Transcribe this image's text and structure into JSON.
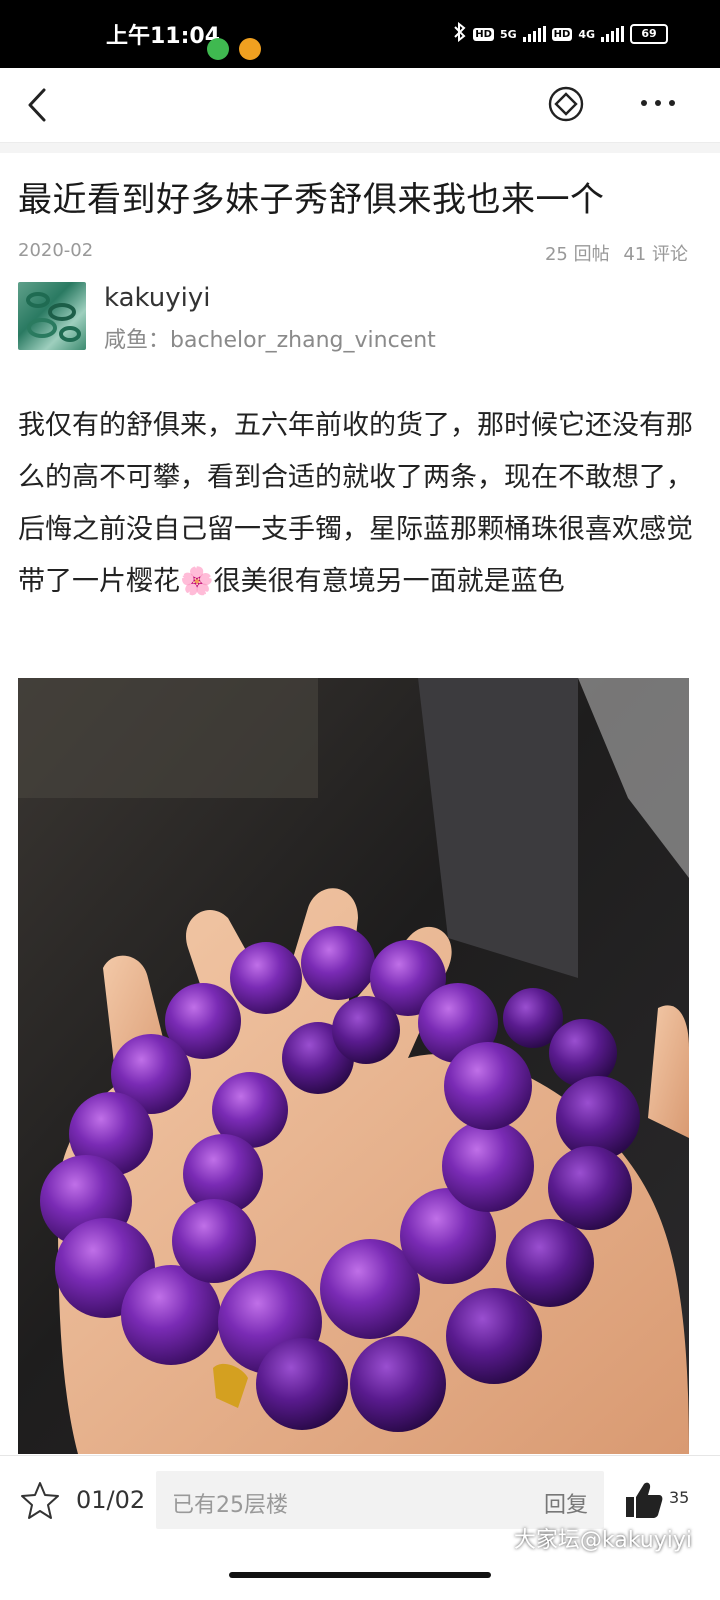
{
  "status_bar": {
    "time": "上午11:04",
    "net1": "5G",
    "net2": "4G",
    "hd": "HD",
    "battery": "69"
  },
  "post": {
    "title": "最近看到好多妹子秀舒俱来我也来一个",
    "date": "2020-02",
    "replies": "25 回帖",
    "comments": "41 评论",
    "author": "kakuyiyi",
    "author_sub": "咸鱼：bachelor_zhang_vincent",
    "body": "我仅有的舒俱来，五六年前收的货了，那时候它还没有那么的高不可攀，看到合适的就收了两条，现在不敢想了，后悔之前没自己留一支手镯，星际蓝那颗桶珠很喜欢感觉带了一片樱花🌸很美很有意境另一面就是蓝色"
  },
  "bottom_bar": {
    "pager": "01/02",
    "reply_placeholder": "已有25层楼",
    "reply_button": "回复",
    "like_count": "35"
  },
  "watermark": "大家坛@kakuyiyi",
  "icons": {
    "back": "chevron-left-icon",
    "share": "diamond-share-icon",
    "more": "more-dots-icon",
    "favorite": "star-icon",
    "like": "thumbs-up-icon"
  }
}
